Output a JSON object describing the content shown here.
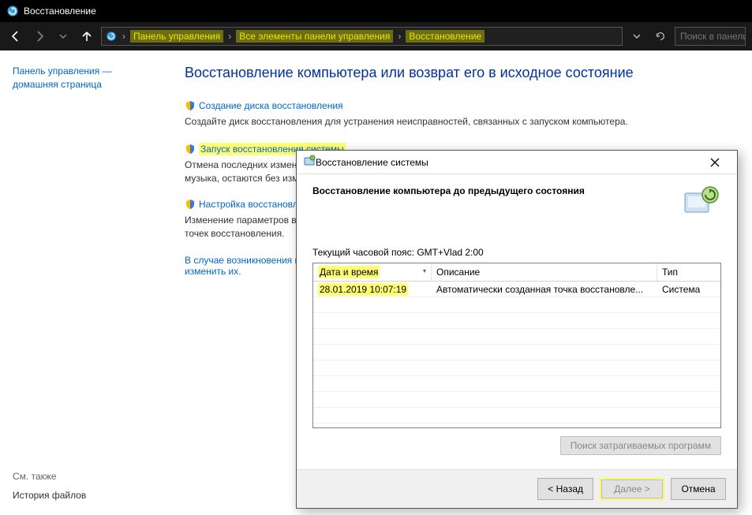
{
  "window": {
    "title": "Восстановление"
  },
  "breadcrumb": {
    "items": [
      "Панель управления",
      "Все элементы панели управления",
      "Восстановление"
    ],
    "search_placeholder": "Поиск в панели"
  },
  "sidebar": {
    "home_link": "Панель управления — домашняя страница",
    "see_also_label": "См. также",
    "history_link": "История файлов"
  },
  "main": {
    "title": "Восстановление компьютера или возврат его в исходное состояние",
    "actions": [
      {
        "link": "Создание диска восстановления",
        "desc": "Создайте диск восстановления для устранения неисправностей, связанных с запуском компьютера.",
        "highlight": false
      },
      {
        "link": "Запуск восстановления системы",
        "desc": "Отмена последних измен\nмузыка, остаются без изме",
        "highlight": true
      },
      {
        "link": "Настройка восстановлен",
        "desc": "Изменение параметров во\nточек восстановления.",
        "highlight": false
      }
    ],
    "hint_line1": "В случае возникновения н",
    "hint_line2": "изменить их."
  },
  "dialog": {
    "title": "Восстановление системы",
    "heading": "Восстановление компьютера до предыдущего состояния",
    "tz_label": "Текущий часовой пояс: GMT+Vlad 2:00",
    "columns": {
      "dt": "Дата и время",
      "desc": "Описание",
      "type": "Тип"
    },
    "rows": [
      {
        "dt": "28.01.2019 10:07:19",
        "desc": "Автоматически созданная точка восстановле...",
        "type": "Система"
      }
    ],
    "affected_btn": "Поиск затрагиваемых программ",
    "back": "< Назад",
    "next": "Далее >",
    "cancel": "Отмена"
  }
}
